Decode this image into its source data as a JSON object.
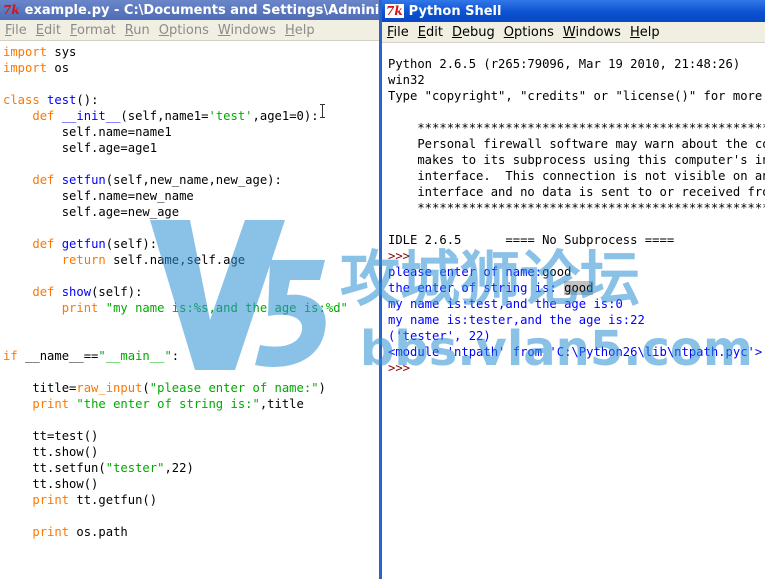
{
  "editor": {
    "title": "example.py - C:\\Documents and Settings\\Administrator\\My Documents\\example.py",
    "icon": "tk-feather-icon",
    "menu": [
      "File",
      "Edit",
      "Format",
      "Run",
      "Options",
      "Windows",
      "Help"
    ],
    "lines": [
      [
        [
          "kw",
          "import"
        ],
        [
          "t",
          " sys"
        ]
      ],
      [
        [
          "kw",
          "import"
        ],
        [
          "t",
          " os"
        ]
      ],
      [
        [
          "t",
          ""
        ]
      ],
      [
        [
          "kw",
          "class"
        ],
        [
          "t",
          " "
        ],
        [
          "def",
          "test"
        ],
        [
          "t",
          "():"
        ]
      ],
      [
        [
          "t",
          "    "
        ],
        [
          "kw",
          "def"
        ],
        [
          "t",
          " "
        ],
        [
          "def",
          "__init__"
        ],
        [
          "t",
          "(self,name1="
        ],
        [
          "str",
          "'test'"
        ],
        [
          "t",
          ",age1=0):"
        ]
      ],
      [
        [
          "t",
          "        self.name=name1"
        ]
      ],
      [
        [
          "t",
          "        self.age=age1"
        ]
      ],
      [
        [
          "t",
          ""
        ]
      ],
      [
        [
          "t",
          "    "
        ],
        [
          "kw",
          "def"
        ],
        [
          "t",
          " "
        ],
        [
          "def",
          "setfun"
        ],
        [
          "t",
          "(self,new_name,new_age):"
        ]
      ],
      [
        [
          "t",
          "        self.name=new_name"
        ]
      ],
      [
        [
          "t",
          "        self.age=new_age"
        ]
      ],
      [
        [
          "t",
          ""
        ]
      ],
      [
        [
          "t",
          "    "
        ],
        [
          "kw",
          "def"
        ],
        [
          "t",
          " "
        ],
        [
          "def",
          "getfun"
        ],
        [
          "t",
          "(self):"
        ]
      ],
      [
        [
          "t",
          "        "
        ],
        [
          "kw",
          "return"
        ],
        [
          "t",
          " self.name,self.age"
        ]
      ],
      [
        [
          "t",
          ""
        ]
      ],
      [
        [
          "t",
          "    "
        ],
        [
          "kw",
          "def"
        ],
        [
          "t",
          " "
        ],
        [
          "def",
          "show"
        ],
        [
          "t",
          "(self):"
        ]
      ],
      [
        [
          "t",
          "        "
        ],
        [
          "kw",
          "print"
        ],
        [
          "t",
          " "
        ],
        [
          "str",
          "\"my name is:%s,and the age is:%d\""
        ]
      ],
      [
        [
          "t",
          ""
        ]
      ],
      [
        [
          "t",
          ""
        ]
      ],
      [
        [
          "kw",
          "if"
        ],
        [
          "t",
          " __name__=="
        ],
        [
          "str",
          "\"__main__\""
        ],
        [
          "t",
          ":"
        ]
      ],
      [
        [
          "t",
          ""
        ]
      ],
      [
        [
          "t",
          "    title="
        ],
        [
          "kw",
          "raw_input"
        ],
        [
          "t",
          "("
        ],
        [
          "str",
          "\"please enter of name:\""
        ],
        [
          "t",
          ")"
        ]
      ],
      [
        [
          "t",
          "    "
        ],
        [
          "kw",
          "print"
        ],
        [
          "t",
          " "
        ],
        [
          "str",
          "\"the enter of string is:\""
        ],
        [
          "t",
          ",title"
        ]
      ],
      [
        [
          "t",
          ""
        ]
      ],
      [
        [
          "t",
          "    tt=test()"
        ]
      ],
      [
        [
          "t",
          "    tt.show()"
        ]
      ],
      [
        [
          "t",
          "    tt.setfun("
        ],
        [
          "str",
          "\"tester\""
        ],
        [
          "t",
          ",22)"
        ]
      ],
      [
        [
          "t",
          "    tt.show()"
        ]
      ],
      [
        [
          "t",
          "    "
        ],
        [
          "kw",
          "print"
        ],
        [
          "t",
          " tt.getfun()"
        ]
      ],
      [
        [
          "t",
          ""
        ]
      ],
      [
        [
          "t",
          "    "
        ],
        [
          "kw",
          "print"
        ],
        [
          "t",
          " os.path"
        ]
      ]
    ]
  },
  "shell": {
    "title": "Python Shell",
    "icon": "tk-feather-icon",
    "menu": [
      "File",
      "Edit",
      "Debug",
      "Options",
      "Windows",
      "Help"
    ],
    "lines": [
      [
        [
          "t",
          "Python 2.6.5 (r265:79096, Mar 19 2010, 21:48:26)"
        ]
      ],
      [
        [
          "t",
          "win32"
        ]
      ],
      [
        [
          "t",
          "Type \"copyright\", \"credits\" or \"license()\" for more"
        ]
      ],
      [
        [
          "t",
          ""
        ]
      ],
      [
        [
          "t",
          "    ****************************************************************"
        ]
      ],
      [
        [
          "t",
          "    Personal firewall software may warn about the connection IDLE"
        ]
      ],
      [
        [
          "t",
          "    makes to its subprocess using this computer's internal loopback"
        ]
      ],
      [
        [
          "t",
          "    interface.  This connection is not visible on any external"
        ]
      ],
      [
        [
          "t",
          "    interface and no data is sent to or received from the Internet."
        ]
      ],
      [
        [
          "t",
          "    ****************************************************************"
        ]
      ],
      [
        [
          "t",
          ""
        ]
      ],
      [
        [
          "t",
          "IDLE 2.6.5      ==== No Subprocess ===="
        ]
      ],
      [
        [
          "prompt",
          ">>> "
        ]
      ],
      [
        [
          "out",
          "please enter of name:"
        ],
        [
          "t",
          "good"
        ]
      ],
      [
        [
          "out",
          "the enter of string is: "
        ],
        [
          "sel",
          "good"
        ]
      ],
      [
        [
          "out",
          "my name is:test,and the age is:0"
        ]
      ],
      [
        [
          "out",
          "my name is:tester,and the age is:22"
        ]
      ],
      [
        [
          "out",
          "('tester', 22)"
        ]
      ],
      [
        [
          "out",
          "<module 'ntpath' from 'C:\\Python26\\lib\\ntpath.pyc'>"
        ]
      ],
      [
        [
          "prompt",
          ">>> "
        ]
      ]
    ]
  },
  "watermark": {
    "logo_text": "V5",
    "cn_text": "攻城狮论坛",
    "url_text": "bbs.vlan5.com",
    "color": "#2a8fd4"
  },
  "colors": {
    "keyword": "#ff7700",
    "definition": "#0000ff",
    "string": "#00aa00",
    "output": "#0000ff",
    "prompt": "#8b0000"
  }
}
